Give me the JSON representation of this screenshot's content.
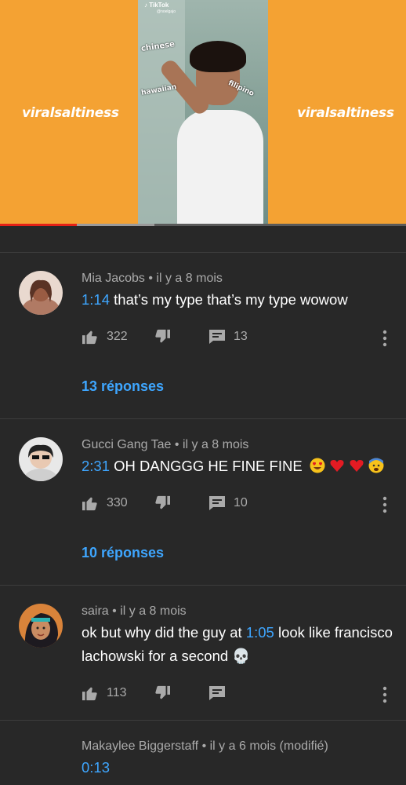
{
  "video": {
    "watermark_left": "viralsaltiness",
    "watermark_right": "viralsaltiness",
    "tiktok_logo": "TikTok",
    "tiktok_handle": "@noelgajo",
    "tags": [
      "chinese",
      "hawaiian",
      "filipino"
    ],
    "progress": 0.19,
    "buffered": 0.38
  },
  "comments": [
    {
      "author": "Mia Jacobs",
      "time": "il y a 8 mois",
      "timestamp": "1:14",
      "text": "that’s my type that’s my type wowow",
      "likes": "322",
      "replies_count": "13",
      "replies_label": "13 réponses",
      "avatar_color": "#c8866a"
    },
    {
      "author": "Gucci Gang Tae",
      "time": "il y a 8 mois",
      "timestamp": "2:31",
      "text": "OH DANGGG HE FINE FINE",
      "emojis": [
        "heart-eyes-emoji",
        "red-heart-emoji",
        "red-heart-emoji",
        "anxious-face-emoji"
      ],
      "likes": "330",
      "replies_count": "10",
      "replies_label": "10 réponses",
      "avatar_color": "#dcdcdc"
    },
    {
      "author": "saira",
      "time": "il y a 8 mois",
      "text_before": "ok but why did the guy at ",
      "timestamp": "1:05",
      "text_after": " look like francisco lachowski for a second ",
      "emoji": "💀",
      "likes": "113",
      "avatar_color": "#d9833a"
    },
    {
      "author": "Makaylee Biggerstaff",
      "time": "il y a 6 mois (modifié)",
      "timestamp": "0:13"
    }
  ],
  "colors": {
    "background": "#282828",
    "link": "#3ea6ff",
    "meta": "#aaaaaa",
    "video_bg": "#f4a233"
  }
}
